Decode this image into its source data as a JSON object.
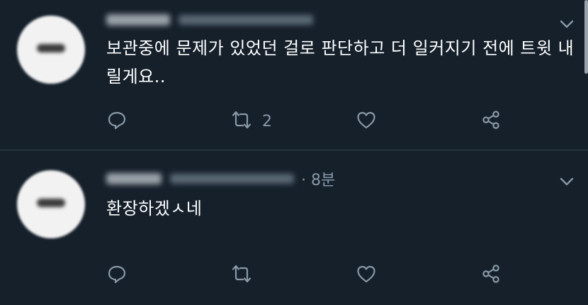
{
  "tweets": [
    {
      "time": "",
      "text": "보관중에 문제가 있었던 걸로 판단하고 더 일커지기 전에 트윗 내릴게요..",
      "retweet_count": "2"
    },
    {
      "time": "· 8분",
      "text": "환장하겠ㅅ네",
      "retweet_count": ""
    }
  ],
  "icons": {
    "reply": "reply-icon",
    "retweet": "retweet-icon",
    "like": "heart-icon",
    "share": "share-icon",
    "menu": "chevron-down-icon"
  },
  "colors": {
    "background": "#15202b",
    "secondary_text": "#8899a6",
    "divider": "#38444d"
  }
}
